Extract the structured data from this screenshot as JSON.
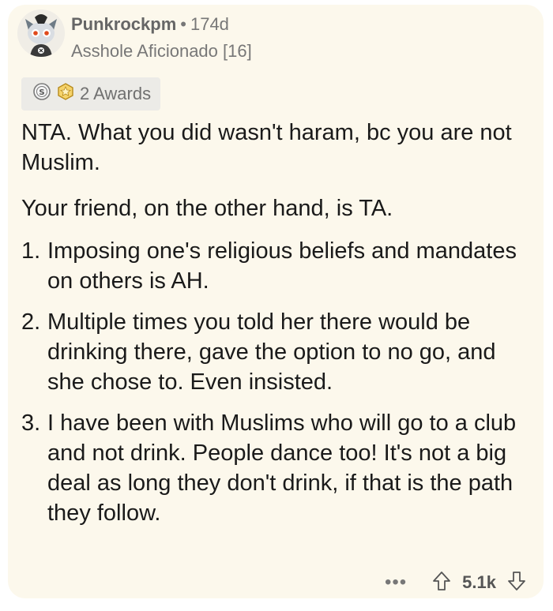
{
  "comment": {
    "author": "Punkrockpm",
    "separator": "•",
    "age": "174d",
    "flair": "Asshole Aficionado [16]",
    "awards_label": "2 Awards",
    "paragraphs": [
      "NTA. What you did wasn't haram, bc you are not Muslim.",
      "Your friend, on the other hand, is TA."
    ],
    "list": [
      {
        "num": "1.",
        "text": "Imposing one's religious beliefs and mandates on others is AH."
      },
      {
        "num": "2.",
        "text": "Multiple times you told her there would be drinking there, gave the option to no go, and she chose to. Even insisted."
      },
      {
        "num": "3.",
        "text": "I have been with Muslims who will go to a club and not drink. People dance too! It's not a big deal as long they don't drink, if that is the path they follow."
      }
    ],
    "more_label": "•••",
    "score": "5.1k"
  },
  "icons": {
    "avatar": "snoo-avatar-icon",
    "award_1": "silver-award-icon",
    "award_2": "helpful-award-icon",
    "upvote": "upvote-arrow-icon",
    "downvote": "downvote-arrow-icon"
  },
  "colors": {
    "card_background": "#fcf8ec",
    "text_primary": "#1a1a1a",
    "text_secondary": "#777777",
    "awards_background": "#ecebe7"
  }
}
